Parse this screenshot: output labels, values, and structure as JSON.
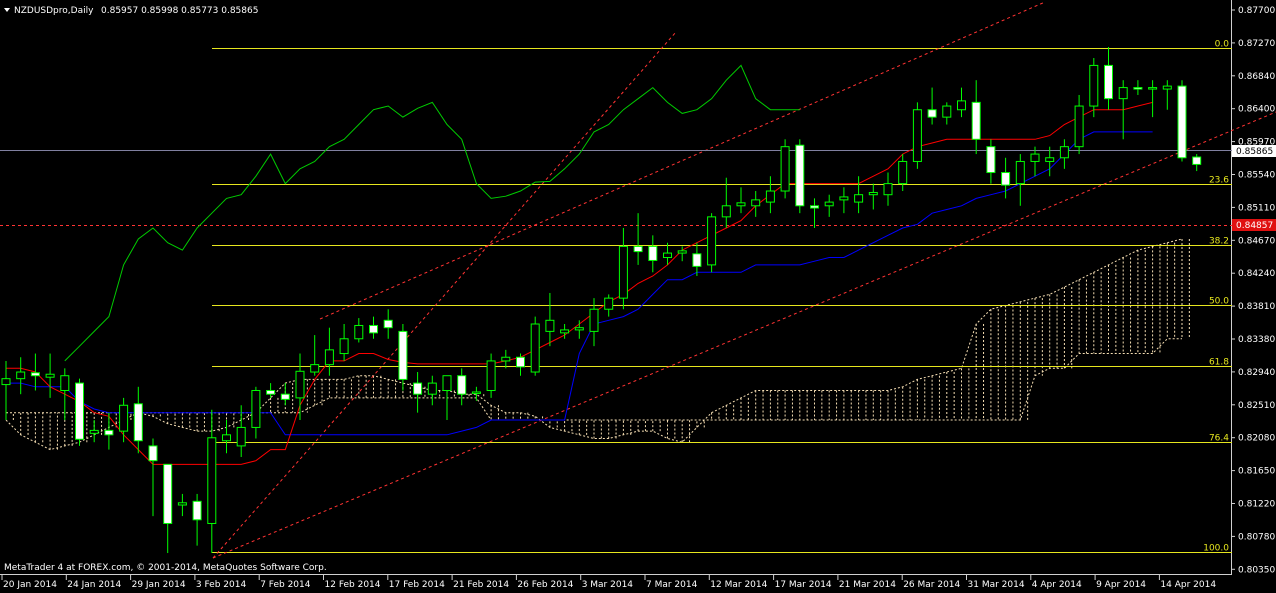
{
  "header": {
    "symbol_text": "NZDUSDpro,Daily",
    "ohlc_text": "0.85957 0.85998 0.85773 0.85865"
  },
  "footer": {
    "copyright": "MetaTrader 4 at FOREX.com, © 2001-2014, MetaQuotes Software Corp."
  },
  "price_axis": {
    "labels": [
      "0.87700",
      "0.87270",
      "0.86840",
      "0.86400",
      "0.85970",
      "0.85540",
      "0.85110",
      "0.84670",
      "0.84240",
      "0.83810",
      "0.83380",
      "0.82940",
      "0.82510",
      "0.82080",
      "0.81650",
      "0.81220",
      "0.80780",
      "0.80350"
    ],
    "current_price": "0.85865",
    "alert_price": "0.84857"
  },
  "date_axis": {
    "labels": [
      "20 Jan 2014",
      "24 Jan 2014",
      "29 Jan 2014",
      "3 Feb 2014",
      "7 Feb 2014",
      "12 Feb 2014",
      "17 Feb 2014",
      "21 Feb 2014",
      "26 Feb 2014",
      "3 Mar 2014",
      "7 Mar 2014",
      "12 Mar 2014",
      "17 Mar 2014",
      "21 Mar 2014",
      "26 Mar 2014",
      "31 Mar 2014",
      "4 Apr 2014",
      "9 Apr 2014",
      "14 Apr 2014"
    ]
  },
  "fibonacci": {
    "levels": [
      "0.0",
      "23.6",
      "38.2",
      "50.0",
      "61.8",
      "76.4",
      "100.0"
    ],
    "prices": [
      0.8744,
      0.856,
      0.8477,
      0.8396,
      0.8313,
      0.821,
      0.8061
    ]
  },
  "colors": {
    "background": "#000000",
    "bull_candle": "#000000",
    "bear_candle": "#ffffff",
    "wick": "#00ff00",
    "chikou": "#00cc00",
    "tenkan": "#ff0000",
    "kijun": "#0000ff",
    "kumo": "#f5deb3",
    "fibo": "#e6e61e",
    "trend": "#ff3333"
  },
  "chart_data": {
    "type": "candlestick",
    "symbol": "NZDUSDpro",
    "timeframe": "Daily",
    "price_range": [
      0.8035,
      0.8795
    ],
    "candles": [
      {
        "date": "17 Jan 2014",
        "o": 0.8288,
        "h": 0.832,
        "l": 0.824,
        "c": 0.8296
      },
      {
        "date": "20 Jan 2014",
        "o": 0.8296,
        "h": 0.8325,
        "l": 0.8275,
        "c": 0.8305
      },
      {
        "date": "21 Jan 2014",
        "o": 0.8304,
        "h": 0.833,
        "l": 0.828,
        "c": 0.83
      },
      {
        "date": "22 Jan 2014",
        "o": 0.8298,
        "h": 0.833,
        "l": 0.827,
        "c": 0.8302
      },
      {
        "date": "23 Jan 2014",
        "o": 0.828,
        "h": 0.831,
        "l": 0.824,
        "c": 0.83
      },
      {
        "date": "24 Jan 2014",
        "o": 0.829,
        "h": 0.8296,
        "l": 0.8205,
        "c": 0.8214
      },
      {
        "date": "27 Jan 2014",
        "o": 0.8222,
        "h": 0.824,
        "l": 0.821,
        "c": 0.8226
      },
      {
        "date": "28 Jan 2014",
        "o": 0.8226,
        "h": 0.825,
        "l": 0.82,
        "c": 0.822
      },
      {
        "date": "29 Jan 2014",
        "o": 0.8225,
        "h": 0.827,
        "l": 0.821,
        "c": 0.826
      },
      {
        "date": "30 Jan 2014",
        "o": 0.8262,
        "h": 0.8285,
        "l": 0.8195,
        "c": 0.8212
      },
      {
        "date": "31 Jan 2014",
        "o": 0.8205,
        "h": 0.8215,
        "l": 0.811,
        "c": 0.8185
      },
      {
        "date": "1 Feb 2014",
        "o": 0.818,
        "h": 0.818,
        "l": 0.806,
        "c": 0.81
      },
      {
        "date": "2 Feb 2014",
        "o": 0.8125,
        "h": 0.814,
        "l": 0.811,
        "c": 0.8128
      },
      {
        "date": "3 Feb 2014",
        "o": 0.813,
        "h": 0.814,
        "l": 0.807,
        "c": 0.8105
      },
      {
        "date": "4 Feb 2014",
        "o": 0.81,
        "h": 0.8254,
        "l": 0.806,
        "c": 0.8216
      },
      {
        "date": "5 Feb 2014",
        "o": 0.8212,
        "h": 0.824,
        "l": 0.8195,
        "c": 0.822
      },
      {
        "date": "6 Feb 2014",
        "o": 0.8205,
        "h": 0.826,
        "l": 0.819,
        "c": 0.823
      },
      {
        "date": "7 Feb 2014",
        "o": 0.823,
        "h": 0.8285,
        "l": 0.8215,
        "c": 0.828
      },
      {
        "date": "10 Feb 2014",
        "o": 0.828,
        "h": 0.829,
        "l": 0.827,
        "c": 0.8275
      },
      {
        "date": "11 Feb 2014",
        "o": 0.8275,
        "h": 0.829,
        "l": 0.826,
        "c": 0.8268
      },
      {
        "date": "12 Feb 2014",
        "o": 0.827,
        "h": 0.833,
        "l": 0.824,
        "c": 0.8306
      },
      {
        "date": "13 Feb 2014",
        "o": 0.8305,
        "h": 0.8355,
        "l": 0.83,
        "c": 0.8315
      },
      {
        "date": "14 Feb 2014",
        "o": 0.8315,
        "h": 0.8365,
        "l": 0.83,
        "c": 0.8335
      },
      {
        "date": "15 Feb 2014",
        "o": 0.833,
        "h": 0.837,
        "l": 0.832,
        "c": 0.835
      },
      {
        "date": "16 Feb 2014",
        "o": 0.835,
        "h": 0.8378,
        "l": 0.8345,
        "c": 0.8368
      },
      {
        "date": "17 Feb 2014",
        "o": 0.8368,
        "h": 0.838,
        "l": 0.835,
        "c": 0.8358
      },
      {
        "date": "18 Feb 2014",
        "o": 0.8375,
        "h": 0.839,
        "l": 0.835,
        "c": 0.8365
      },
      {
        "date": "19 Feb 2014",
        "o": 0.836,
        "h": 0.837,
        "l": 0.828,
        "c": 0.8295
      },
      {
        "date": "20 Feb 2014",
        "o": 0.829,
        "h": 0.8305,
        "l": 0.825,
        "c": 0.8275
      },
      {
        "date": "21 Feb 2014",
        "o": 0.8275,
        "h": 0.83,
        "l": 0.826,
        "c": 0.829
      },
      {
        "date": "22 Feb 2014",
        "o": 0.828,
        "h": 0.83,
        "l": 0.824,
        "c": 0.83
      },
      {
        "date": "23 Feb 2014",
        "o": 0.83,
        "h": 0.831,
        "l": 0.826,
        "c": 0.8275
      },
      {
        "date": "24 Feb 2014",
        "o": 0.8276,
        "h": 0.8285,
        "l": 0.8266,
        "c": 0.8278
      },
      {
        "date": "25 Feb 2014",
        "o": 0.828,
        "h": 0.833,
        "l": 0.827,
        "c": 0.832
      },
      {
        "date": "26 Feb 2014",
        "o": 0.832,
        "h": 0.8335,
        "l": 0.831,
        "c": 0.8325
      },
      {
        "date": "27 Feb 2014",
        "o": 0.8325,
        "h": 0.833,
        "l": 0.83,
        "c": 0.8312
      },
      {
        "date": "28 Feb 2014",
        "o": 0.8305,
        "h": 0.838,
        "l": 0.83,
        "c": 0.837
      },
      {
        "date": "1 Mar 2014",
        "o": 0.836,
        "h": 0.8412,
        "l": 0.834,
        "c": 0.8375
      },
      {
        "date": "2 Mar 2014",
        "o": 0.8358,
        "h": 0.837,
        "l": 0.835,
        "c": 0.8362
      },
      {
        "date": "3 Mar 2014",
        "o": 0.8362,
        "h": 0.8375,
        "l": 0.835,
        "c": 0.8365
      },
      {
        "date": "4 Mar 2014",
        "o": 0.836,
        "h": 0.8405,
        "l": 0.834,
        "c": 0.839
      },
      {
        "date": "5 Mar 2014",
        "o": 0.839,
        "h": 0.841,
        "l": 0.838,
        "c": 0.8405
      },
      {
        "date": "6 Mar 2014",
        "o": 0.8405,
        "h": 0.85,
        "l": 0.839,
        "c": 0.8475
      },
      {
        "date": "7 Mar 2014",
        "o": 0.8475,
        "h": 0.852,
        "l": 0.845,
        "c": 0.8468
      },
      {
        "date": "8 Mar 2014",
        "o": 0.8475,
        "h": 0.849,
        "l": 0.844,
        "c": 0.8456
      },
      {
        "date": "9 Mar 2014",
        "o": 0.846,
        "h": 0.848,
        "l": 0.845,
        "c": 0.8466
      },
      {
        "date": "10 Mar 2014",
        "o": 0.8466,
        "h": 0.8475,
        "l": 0.8455,
        "c": 0.8469
      },
      {
        "date": "11 Mar 2014",
        "o": 0.8465,
        "h": 0.848,
        "l": 0.8435,
        "c": 0.8448
      },
      {
        "date": "12 Mar 2014",
        "o": 0.845,
        "h": 0.852,
        "l": 0.844,
        "c": 0.8515
      },
      {
        "date": "13 Mar 2014",
        "o": 0.8515,
        "h": 0.8568,
        "l": 0.85,
        "c": 0.853
      },
      {
        "date": "14 Mar 2014",
        "o": 0.853,
        "h": 0.8555,
        "l": 0.852,
        "c": 0.8534
      },
      {
        "date": "15 Mar 2014",
        "o": 0.853,
        "h": 0.855,
        "l": 0.8515,
        "c": 0.8538
      },
      {
        "date": "16 Mar 2014",
        "o": 0.8535,
        "h": 0.857,
        "l": 0.852,
        "c": 0.855
      },
      {
        "date": "17 Mar 2014",
        "o": 0.855,
        "h": 0.862,
        "l": 0.854,
        "c": 0.861
      },
      {
        "date": "18 Mar 2014",
        "o": 0.8612,
        "h": 0.862,
        "l": 0.852,
        "c": 0.853
      },
      {
        "date": "19 Mar 2014",
        "o": 0.853,
        "h": 0.854,
        "l": 0.85,
        "c": 0.8527
      },
      {
        "date": "20 Mar 2014",
        "o": 0.853,
        "h": 0.8545,
        "l": 0.8515,
        "c": 0.8535
      },
      {
        "date": "21 Mar 2014",
        "o": 0.8538,
        "h": 0.8555,
        "l": 0.852,
        "c": 0.8542
      },
      {
        "date": "22 Mar 2014",
        "o": 0.8535,
        "h": 0.857,
        "l": 0.852,
        "c": 0.8545
      },
      {
        "date": "23 Mar 2014",
        "o": 0.8545,
        "h": 0.856,
        "l": 0.8525,
        "c": 0.8548
      },
      {
        "date": "24 Mar 2014",
        "o": 0.8545,
        "h": 0.8575,
        "l": 0.853,
        "c": 0.856
      },
      {
        "date": "25 Mar 2014",
        "o": 0.856,
        "h": 0.86,
        "l": 0.855,
        "c": 0.859
      },
      {
        "date": "26 Mar 2014",
        "o": 0.859,
        "h": 0.867,
        "l": 0.858,
        "c": 0.866
      },
      {
        "date": "27 Mar 2014",
        "o": 0.866,
        "h": 0.869,
        "l": 0.864,
        "c": 0.865
      },
      {
        "date": "28 Mar 2014",
        "o": 0.865,
        "h": 0.867,
        "l": 0.864,
        "c": 0.8665
      },
      {
        "date": "29 Mar 2014",
        "o": 0.866,
        "h": 0.869,
        "l": 0.865,
        "c": 0.8672
      },
      {
        "date": "30 Mar 2014",
        "o": 0.867,
        "h": 0.87,
        "l": 0.86,
        "c": 0.862
      },
      {
        "date": "31 Mar 2014",
        "o": 0.861,
        "h": 0.862,
        "l": 0.856,
        "c": 0.8575
      },
      {
        "date": "1 Apr 2014",
        "o": 0.8575,
        "h": 0.8595,
        "l": 0.854,
        "c": 0.8558
      },
      {
        "date": "2 Apr 2014",
        "o": 0.856,
        "h": 0.86,
        "l": 0.853,
        "c": 0.859
      },
      {
        "date": "3 Apr 2014",
        "o": 0.859,
        "h": 0.861,
        "l": 0.857,
        "c": 0.86
      },
      {
        "date": "4 Apr 2014",
        "o": 0.859,
        "h": 0.861,
        "l": 0.857,
        "c": 0.8595
      },
      {
        "date": "5 Apr 2014",
        "o": 0.8595,
        "h": 0.862,
        "l": 0.858,
        "c": 0.861
      },
      {
        "date": "6 Apr 2014",
        "o": 0.861,
        "h": 0.868,
        "l": 0.86,
        "c": 0.8665
      },
      {
        "date": "7 Apr 2014",
        "o": 0.8665,
        "h": 0.873,
        "l": 0.865,
        "c": 0.872
      },
      {
        "date": "8 Apr 2014",
        "o": 0.872,
        "h": 0.8745,
        "l": 0.866,
        "c": 0.8675
      },
      {
        "date": "9 Apr 2014",
        "o": 0.8675,
        "h": 0.87,
        "l": 0.862,
        "c": 0.869
      },
      {
        "date": "10 Apr 2014",
        "o": 0.869,
        "h": 0.87,
        "l": 0.868,
        "c": 0.8688
      },
      {
        "date": "11 Apr 2014",
        "o": 0.8688,
        "h": 0.87,
        "l": 0.865,
        "c": 0.869
      },
      {
        "date": "12 Apr 2014",
        "o": 0.8688,
        "h": 0.87,
        "l": 0.866,
        "c": 0.8692
      },
      {
        "date": "14 Apr 2014",
        "o": 0.8692,
        "h": 0.87,
        "l": 0.859,
        "c": 0.8595
      },
      {
        "date": "15 Apr 2014",
        "o": 0.8596,
        "h": 0.86,
        "l": 0.8577,
        "c": 0.8586
      }
    ],
    "chikou": [
      0.832,
      0.834,
      0.836,
      0.838,
      0.845,
      0.8485,
      0.85,
      0.848,
      0.847,
      0.85,
      0.852,
      0.854,
      0.8545,
      0.857,
      0.86,
      0.856,
      0.858,
      0.859,
      0.861,
      0.862,
      0.864,
      0.866,
      0.8665,
      0.865,
      0.8662,
      0.867,
      0.864,
      0.862,
      0.856,
      0.854,
      0.8543,
      0.855,
      0.8562,
      0.8563,
      0.858,
      0.86,
      0.863,
      0.864,
      0.866,
      0.8675,
      0.869,
      0.867,
      0.8655,
      0.866,
      0.8675,
      0.87,
      0.872,
      0.8675,
      0.866,
      0.866,
      0.866
    ],
    "tenkan": [
      0.831,
      0.831,
      0.8305,
      0.8285,
      0.8275,
      0.8265,
      0.825,
      0.8245,
      0.822,
      0.82,
      0.818,
      0.818,
      0.818,
      0.818,
      0.818,
      0.818,
      0.818,
      0.8185,
      0.82,
      0.82,
      0.826,
      0.8295,
      0.832,
      0.832,
      0.833,
      0.833,
      0.8322,
      0.8318,
      0.8316,
      0.8316,
      0.8316,
      0.8316,
      0.8316,
      0.8316,
      0.832,
      0.8325,
      0.8335,
      0.8345,
      0.8355,
      0.837,
      0.8385,
      0.84,
      0.841,
      0.8425,
      0.8435,
      0.845,
      0.847,
      0.848,
      0.849,
      0.85,
      0.851,
      0.853,
      0.8545,
      0.856,
      0.856,
      0.856,
      0.856,
      0.856,
      0.856,
      0.857,
      0.858,
      0.86,
      0.861,
      0.8615,
      0.862,
      0.862,
      0.862,
      0.862,
      0.862,
      0.862,
      0.862,
      0.8625,
      0.864,
      0.865,
      0.866,
      0.866,
      0.866,
      0.8665,
      0.867
    ],
    "kijun": [
      0.829,
      0.829,
      0.8285,
      0.8285,
      0.8285,
      0.8265,
      0.8255,
      0.825,
      0.825,
      0.825,
      0.825,
      0.825,
      0.825,
      0.825,
      0.825,
      0.825,
      0.825,
      0.825,
      0.825,
      0.822,
      0.822,
      0.822,
      0.822,
      0.822,
      0.822,
      0.822,
      0.822,
      0.822,
      0.822,
      0.822,
      0.822,
      0.8225,
      0.823,
      0.824,
      0.824,
      0.824,
      0.824,
      0.824,
      0.824,
      0.833,
      0.837,
      0.8375,
      0.838,
      0.839,
      0.841,
      0.843,
      0.843,
      0.844,
      0.844,
      0.844,
      0.844,
      0.845,
      0.845,
      0.845,
      0.845,
      0.8455,
      0.846,
      0.846,
      0.847,
      0.848,
      0.849,
      0.85,
      0.8505,
      0.852,
      0.8525,
      0.853,
      0.854,
      0.8545,
      0.855,
      0.856,
      0.857,
      0.858,
      0.86,
      0.862,
      0.863,
      0.863,
      0.863,
      0.863,
      0.863
    ],
    "senkou_a": [
      0.824,
      0.822,
      0.821,
      0.82,
      0.8205,
      0.821,
      0.822,
      0.823,
      0.824,
      0.825,
      0.8245,
      0.8235,
      0.823,
      0.8225,
      0.8225,
      0.823,
      0.824,
      0.825,
      0.827,
      0.829,
      0.8295,
      0.8295,
      0.8295,
      0.8295,
      0.83,
      0.83,
      0.8295,
      0.829,
      0.8285,
      0.828,
      0.828,
      0.8275,
      0.8275,
      0.826,
      0.825,
      0.825,
      0.8245,
      0.823,
      0.8225,
      0.822,
      0.8215,
      0.8215,
      0.822,
      0.8225,
      0.8225,
      0.8215,
      0.821,
      0.823,
      0.825,
      0.826,
      0.827,
      0.828,
      0.828,
      0.828,
      0.828,
      0.828,
      0.828,
      0.828,
      0.828,
      0.828,
      0.828,
      0.8285,
      0.8295,
      0.83,
      0.8305,
      0.831,
      0.837,
      0.839,
      0.8395,
      0.84,
      0.8405,
      0.841,
      0.842,
      0.843,
      0.844,
      0.845,
      0.846,
      0.847,
      0.8475,
      0.848,
      0.8485
    ],
    "senkou_b": [
      0.825,
      0.825,
      0.825,
      0.825,
      0.825,
      0.825,
      0.825,
      0.825,
      0.825,
      0.825,
      0.825,
      0.825,
      0.825,
      0.825,
      0.825,
      0.825,
      0.825,
      0.825,
      0.825,
      0.825,
      0.825,
      0.826,
      0.827,
      0.827,
      0.827,
      0.827,
      0.827,
      0.827,
      0.827,
      0.827,
      0.827,
      0.827,
      0.827,
      0.824,
      0.824,
      0.824,
      0.824,
      0.824,
      0.824,
      0.824,
      0.824,
      0.824,
      0.824,
      0.824,
      0.824,
      0.824,
      0.824,
      0.824,
      0.824,
      0.824,
      0.824,
      0.824,
      0.824,
      0.824,
      0.824,
      0.824,
      0.824,
      0.824,
      0.824,
      0.824,
      0.824,
      0.824,
      0.824,
      0.824,
      0.824,
      0.824,
      0.824,
      0.824,
      0.824,
      0.824,
      0.83,
      0.831,
      0.831,
      0.833,
      0.833,
      0.833,
      0.833,
      0.833,
      0.833,
      0.835,
      0.835
    ]
  }
}
